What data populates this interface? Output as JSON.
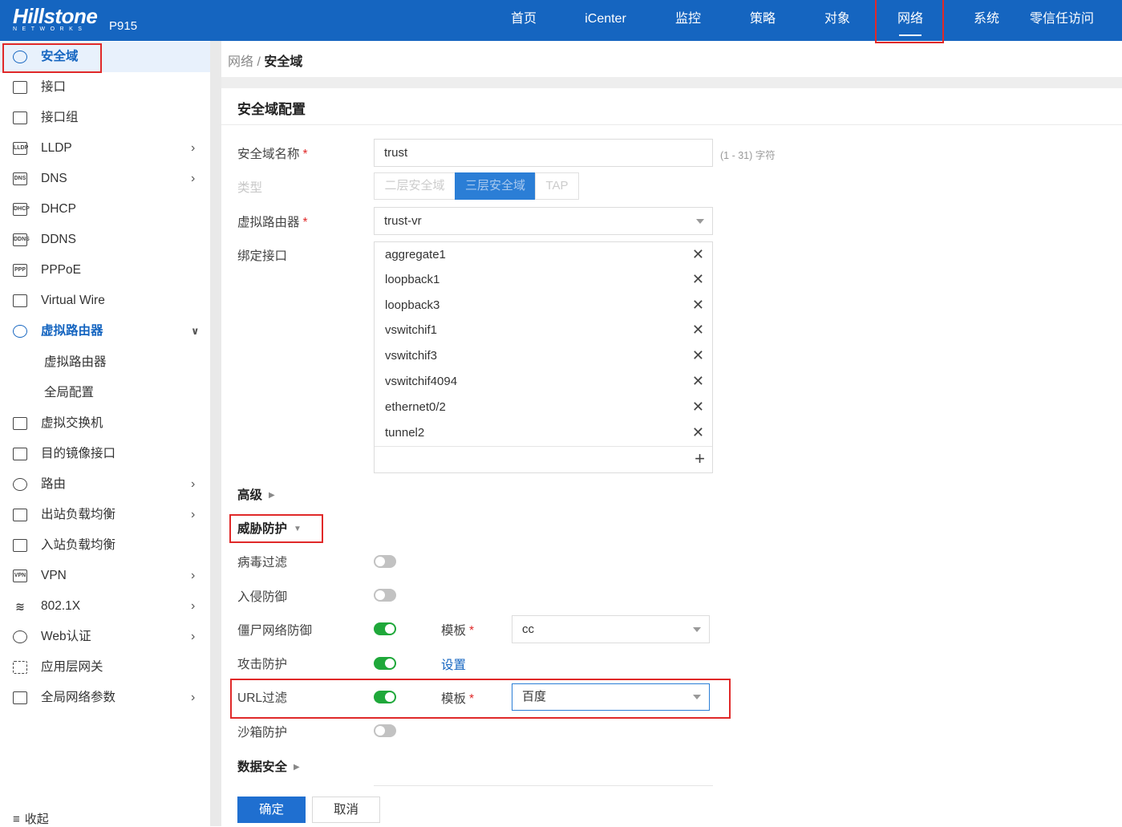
{
  "header": {
    "logo_main": "Hillstone",
    "logo_sub": "NETWORKS",
    "model": "P915",
    "nav": [
      "首页",
      "iCenter",
      "监控",
      "策略",
      "对象",
      "网络",
      "系统",
      "零信任访问"
    ],
    "active_nav": "网络"
  },
  "sidebar": {
    "items": [
      {
        "label": "安全域",
        "icon": "shield-icon",
        "glyph": ""
      },
      {
        "label": "接口",
        "icon": "interface-icon",
        "glyph": ""
      },
      {
        "label": "接口组",
        "icon": "interface-group-icon",
        "glyph": ""
      },
      {
        "label": "LLDP",
        "icon": "lldp-icon",
        "glyph": "LLDP"
      },
      {
        "label": "DNS",
        "icon": "dns-icon",
        "glyph": "DNS"
      },
      {
        "label": "DHCP",
        "icon": "dhcp-icon",
        "glyph": "DHCP"
      },
      {
        "label": "DDNS",
        "icon": "ddns-icon",
        "glyph": "DDNS"
      },
      {
        "label": "PPPoE",
        "icon": "pppoe-icon",
        "glyph": "PPP"
      },
      {
        "label": "Virtual Wire",
        "icon": "virtual-wire-icon",
        "glyph": ""
      },
      {
        "label": "虚拟路由器",
        "icon": "virtual-router-icon",
        "glyph": ""
      },
      {
        "label": "虚拟路由器",
        "icon": "",
        "glyph": ""
      },
      {
        "label": "全局配置",
        "icon": "",
        "glyph": ""
      },
      {
        "label": "虚拟交换机",
        "icon": "virtual-switch-icon",
        "glyph": ""
      },
      {
        "label": "目的镜像接口",
        "icon": "mirror-icon",
        "glyph": ""
      },
      {
        "label": "路由",
        "icon": "route-icon",
        "glyph": ""
      },
      {
        "label": "出站负载均衡",
        "icon": "outbound-lb-icon",
        "glyph": ""
      },
      {
        "label": "入站负载均衡",
        "icon": "inbound-lb-icon",
        "glyph": ""
      },
      {
        "label": "VPN",
        "icon": "vpn-icon",
        "glyph": "VPN"
      },
      {
        "label": "802.1X",
        "icon": "wifi-icon",
        "glyph": ""
      },
      {
        "label": "Web认证",
        "icon": "web-auth-icon",
        "glyph": ""
      },
      {
        "label": "应用层网关",
        "icon": "alg-icon",
        "glyph": ""
      },
      {
        "label": "全局网络参数",
        "icon": "global-params-icon",
        "glyph": ""
      }
    ],
    "collapse_label": "收起"
  },
  "breadcrumb": {
    "parent": "网络",
    "sep": "/",
    "current": "安全域"
  },
  "form": {
    "title": "安全域配置",
    "name_label": "安全域名称",
    "name_value": "trust",
    "name_hint": "(1 - 31) 字符",
    "type_label": "类型",
    "type_options": [
      "二层安全域",
      "三层安全域",
      "TAP"
    ],
    "type_selected": "三层安全域",
    "vr_label": "虚拟路由器",
    "vr_value": "trust-vr",
    "bind_label": "绑定接口",
    "interfaces": [
      "aggregate1",
      "loopback1",
      "loopback3",
      "vswitchif1",
      "vswitchif3",
      "vswitchif4094",
      "ethernet0/2",
      "tunnel2"
    ],
    "advanced_label": "高级",
    "threat_label": "威胁防护",
    "virus_label": "病毒过滤",
    "virus_on": false,
    "ips_label": "入侵防御",
    "ips_on": false,
    "botnet_label": "僵尸网络防御",
    "botnet_on": true,
    "template_label": "模板",
    "botnet_template": "cc",
    "attack_label": "攻击防护",
    "attack_on": true,
    "attack_link": "设置",
    "url_label": "URL过滤",
    "url_on": true,
    "url_template": "百度",
    "sandbox_label": "沙箱防护",
    "sandbox_on": false,
    "data_security_label": "数据安全",
    "ok_label": "确定",
    "cancel_label": "取消"
  },
  "colors": {
    "brand": "#1565c0",
    "highlight": "#e02929",
    "toggle_on": "#1fa83a"
  }
}
